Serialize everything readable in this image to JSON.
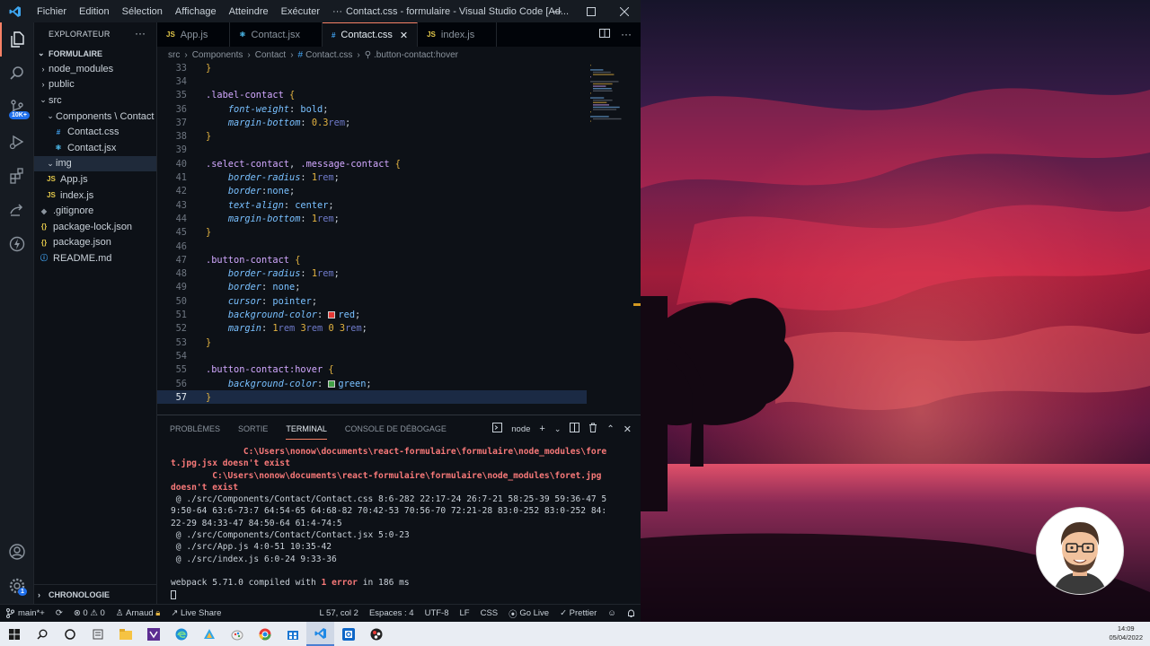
{
  "window": {
    "title": "Contact.css - formulaire - Visual Studio Code [Ad...",
    "menu": [
      "Fichier",
      "Edition",
      "Sélection",
      "Affichage",
      "Atteindre",
      "Exécuter",
      "···"
    ]
  },
  "activity_bar": {
    "items": [
      "explorer-icon",
      "search-icon",
      "source-control-icon",
      "run-debug-icon",
      "extensions-icon",
      "remote-icon",
      "thunder-icon"
    ],
    "badge": "10K+",
    "bottom_items": [
      "account-icon",
      "manage-gear-icon"
    ],
    "gear_badge": "1"
  },
  "sidebar": {
    "header": "EXPLORATEUR",
    "more": "···",
    "project": "FORMULAIRE",
    "tree": [
      {
        "label": "node_modules",
        "indent": 1,
        "type": "folder",
        "open": false
      },
      {
        "label": "public",
        "indent": 1,
        "type": "folder",
        "open": false
      },
      {
        "label": "src",
        "indent": 1,
        "type": "folder",
        "open": true
      },
      {
        "label": "Components \\ Contact",
        "indent": 2,
        "type": "folder",
        "open": true
      },
      {
        "label": "Contact.css",
        "indent": 3,
        "type": "css"
      },
      {
        "label": "Contact.jsx",
        "indent": 3,
        "type": "react"
      },
      {
        "label": "img",
        "indent": 2,
        "type": "folder",
        "open": true,
        "selected": true
      },
      {
        "label": "App.js",
        "indent": 2,
        "type": "js"
      },
      {
        "label": "index.js",
        "indent": 2,
        "type": "js"
      },
      {
        "label": ".gitignore",
        "indent": 1,
        "type": "git"
      },
      {
        "label": "package-lock.json",
        "indent": 1,
        "type": "json"
      },
      {
        "label": "package.json",
        "indent": 1,
        "type": "json"
      },
      {
        "label": "README.md",
        "indent": 1,
        "type": "info"
      }
    ],
    "timeline": "CHRONOLOGIE"
  },
  "tabs": [
    {
      "label": "App.js",
      "icon": "JS",
      "type": "js",
      "active": false
    },
    {
      "label": "Contact.jsx",
      "icon": "⚛",
      "type": "react",
      "active": false
    },
    {
      "label": "Contact.css",
      "icon": "#",
      "type": "css",
      "active": true
    },
    {
      "label": "index.js",
      "icon": "JS",
      "type": "js",
      "active": false
    }
  ],
  "breadcrumb": [
    "src",
    "Components",
    "Contact",
    "Contact.css",
    ".button-contact:hover"
  ],
  "editor": {
    "lines": [
      {
        "n": 33,
        "tokens": [
          [
            "brace",
            "}"
          ]
        ]
      },
      {
        "n": 34,
        "tokens": []
      },
      {
        "n": 35,
        "tokens": [
          [
            "sel",
            ".label-contact "
          ],
          [
            "brace",
            "{"
          ]
        ]
      },
      {
        "n": 36,
        "tokens": [
          [
            "ws",
            "    "
          ],
          [
            "prop",
            "font-weight"
          ],
          [
            "punc",
            ": "
          ],
          [
            "val",
            "bold"
          ],
          [
            "punc",
            ";"
          ]
        ]
      },
      {
        "n": 37,
        "tokens": [
          [
            "ws",
            "    "
          ],
          [
            "prop",
            "margin-bottom"
          ],
          [
            "punc",
            ": "
          ],
          [
            "num",
            "0.3"
          ],
          [
            "unit",
            "rem"
          ],
          [
            "punc",
            ";"
          ]
        ]
      },
      {
        "n": 38,
        "tokens": [
          [
            "brace",
            "}"
          ]
        ]
      },
      {
        "n": 39,
        "tokens": []
      },
      {
        "n": 40,
        "tokens": [
          [
            "sel",
            ".select-contact"
          ],
          [
            "punc",
            ", "
          ],
          [
            "sel",
            ".message-contact "
          ],
          [
            "brace",
            "{"
          ]
        ]
      },
      {
        "n": 41,
        "tokens": [
          [
            "ws",
            "    "
          ],
          [
            "prop",
            "border-radius"
          ],
          [
            "punc",
            ": "
          ],
          [
            "num",
            "1"
          ],
          [
            "unit",
            "rem"
          ],
          [
            "punc",
            ";"
          ]
        ]
      },
      {
        "n": 42,
        "tokens": [
          [
            "ws",
            "    "
          ],
          [
            "prop",
            "border"
          ],
          [
            "punc",
            ":"
          ],
          [
            "val",
            "none"
          ],
          [
            "punc",
            ";"
          ]
        ]
      },
      {
        "n": 43,
        "tokens": [
          [
            "ws",
            "    "
          ],
          [
            "prop",
            "text-align"
          ],
          [
            "punc",
            ": "
          ],
          [
            "val",
            "center"
          ],
          [
            "punc",
            ";"
          ]
        ]
      },
      {
        "n": 44,
        "tokens": [
          [
            "ws",
            "    "
          ],
          [
            "prop",
            "margin-bottom"
          ],
          [
            "punc",
            ": "
          ],
          [
            "num",
            "1"
          ],
          [
            "unit",
            "rem"
          ],
          [
            "punc",
            ";"
          ]
        ]
      },
      {
        "n": 45,
        "tokens": [
          [
            "brace",
            "}"
          ]
        ]
      },
      {
        "n": 46,
        "tokens": []
      },
      {
        "n": 47,
        "tokens": [
          [
            "sel",
            ".button-contact "
          ],
          [
            "brace",
            "{"
          ]
        ]
      },
      {
        "n": 48,
        "tokens": [
          [
            "ws",
            "    "
          ],
          [
            "prop",
            "border-radius"
          ],
          [
            "punc",
            ": "
          ],
          [
            "num",
            "1"
          ],
          [
            "unit",
            "rem"
          ],
          [
            "punc",
            ";"
          ]
        ]
      },
      {
        "n": 49,
        "tokens": [
          [
            "ws",
            "    "
          ],
          [
            "prop",
            "border"
          ],
          [
            "punc",
            ": "
          ],
          [
            "val",
            "none"
          ],
          [
            "punc",
            ";"
          ]
        ]
      },
      {
        "n": 50,
        "tokens": [
          [
            "ws",
            "    "
          ],
          [
            "prop",
            "cursor"
          ],
          [
            "punc",
            ": "
          ],
          [
            "val",
            "pointer"
          ],
          [
            "punc",
            ";"
          ]
        ]
      },
      {
        "n": 51,
        "tokens": [
          [
            "ws",
            "    "
          ],
          [
            "prop",
            "background-color"
          ],
          [
            "punc",
            ": "
          ],
          [
            "swatch",
            "#e53935"
          ],
          [
            "val",
            "red"
          ],
          [
            "punc",
            ";"
          ]
        ]
      },
      {
        "n": 52,
        "tokens": [
          [
            "ws",
            "    "
          ],
          [
            "prop",
            "margin"
          ],
          [
            "punc",
            ": "
          ],
          [
            "num",
            "1"
          ],
          [
            "unit",
            "rem "
          ],
          [
            "num",
            "3"
          ],
          [
            "unit",
            "rem "
          ],
          [
            "num",
            "0 3"
          ],
          [
            "unit",
            "rem"
          ],
          [
            "punc",
            ";"
          ]
        ]
      },
      {
        "n": 53,
        "tokens": [
          [
            "brace",
            "}"
          ]
        ]
      },
      {
        "n": 54,
        "tokens": []
      },
      {
        "n": 55,
        "tokens": [
          [
            "sel",
            ".button-contact:hover "
          ],
          [
            "brace",
            "{"
          ]
        ]
      },
      {
        "n": 56,
        "tokens": [
          [
            "ws",
            "    "
          ],
          [
            "prop",
            "background-color"
          ],
          [
            "punc",
            ": "
          ],
          [
            "swatch",
            "#43a047"
          ],
          [
            "val",
            "green"
          ],
          [
            "punc",
            ";"
          ]
        ]
      },
      {
        "n": 57,
        "tokens": [
          [
            "brace",
            "}"
          ]
        ],
        "current": true
      }
    ]
  },
  "panel": {
    "tabs": [
      "PROBLÈMES",
      "SORTIE",
      "TERMINAL",
      "CONSOLE DE DÉBOGAGE"
    ],
    "active_tab": "TERMINAL",
    "terminal_name": "node",
    "terminal_lines": [
      {
        "cls": "t-err",
        "text": "              C:\\Users\\nonow\\documents\\react-formulaire\\formulaire\\node_modules\\fore"
      },
      {
        "cls": "t-err",
        "text": "t.jpg.jsx doesn't exist"
      },
      {
        "cls": "t-err",
        "text": "        C:\\Users\\nonow\\documents\\react-formulaire\\formulaire\\node_modules\\foret.jpg"
      },
      {
        "cls": "t-err",
        "text": "doesn't exist"
      },
      {
        "cls": "",
        "text": " @ ./src/Components/Contact/Contact.css 8:6-282 22:17-24 26:7-21 58:25-39 59:36-47 5"
      },
      {
        "cls": "",
        "text": "9:50-64 63:6-73:7 64:54-65 64:68-82 70:42-53 70:56-70 72:21-28 83:0-252 83:0-252 84:"
      },
      {
        "cls": "",
        "text": "22-29 84:33-47 84:50-64 61:4-74:5"
      },
      {
        "cls": "",
        "text": " @ ./src/Components/Contact/Contact.jsx 5:0-23"
      },
      {
        "cls": "",
        "text": " @ ./src/App.js 4:0-51 10:35-42"
      },
      {
        "cls": "",
        "text": " @ ./src/index.js 6:0-24 9:33-36"
      },
      {
        "cls": "",
        "text": ""
      }
    ],
    "compiled_prefix": "webpack 5.71.0 compiled with ",
    "compiled_error": "1 error",
    "compiled_suffix": " in 186 ms"
  },
  "statusbar": {
    "branch": "main*+",
    "errors": "0",
    "warnings": "0",
    "user": "Arnaud",
    "live_share": "Live Share",
    "position": "L 57, col 2",
    "spaces": "Espaces : 4",
    "encoding": "UTF-8",
    "eol": "LF",
    "language": "CSS",
    "go_live": "Go Live",
    "prettier": "Prettier"
  },
  "taskbar": {
    "apps": [
      "windows-start-icon",
      "search-icon",
      "task-view-icon",
      "widgets-icon",
      "file-explorer-icon",
      "visual-studio-icon",
      "edge-icon",
      "sourcetree-icon",
      "paint-icon",
      "chrome-icon",
      "store-icon",
      "vscode-icon",
      "outlook-icon",
      "obs-icon"
    ],
    "time": "14:09",
    "date": "05/04/2022"
  },
  "colors": {
    "accent": "#f78166",
    "editor_bg": "#0d1117",
    "error": "#f87979"
  }
}
